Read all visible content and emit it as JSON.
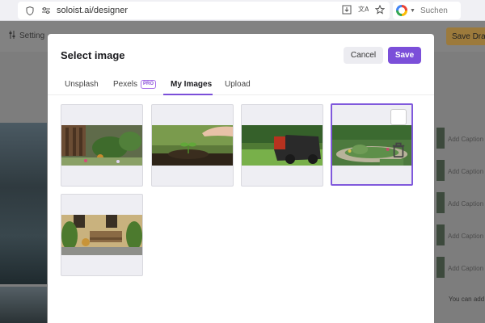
{
  "browser": {
    "url": "soloist.ai/designer",
    "search_placeholder": "Suchen",
    "search_engine_icon": "google-icon"
  },
  "background_app": {
    "settings_label": "Setting",
    "save_draft_label": "Save Draft",
    "captions": [
      "Add Caption",
      "Add Caption",
      "Add Caption",
      "Add Caption",
      "Add Caption"
    ],
    "footer_text": "You can add"
  },
  "modal": {
    "title": "Select image",
    "cancel_label": "Cancel",
    "save_label": "Save",
    "tabs": [
      {
        "label": "Unsplash"
      },
      {
        "label": "Pexels",
        "badge": "PRO"
      },
      {
        "label": "My Images"
      },
      {
        "label": "Upload"
      }
    ],
    "active_tab": "My Images",
    "accent_color": "#7b4fd9",
    "images": [
      {
        "subject": "garden tools and flowers",
        "selected": false
      },
      {
        "subject": "hand watering seedling",
        "selected": false
      },
      {
        "subject": "lawn mower on grass",
        "selected": false
      },
      {
        "subject": "landscaped garden",
        "selected": true,
        "action_icon": "trash-icon"
      },
      {
        "subject": "garden bench in front of house",
        "selected": false
      }
    ]
  }
}
